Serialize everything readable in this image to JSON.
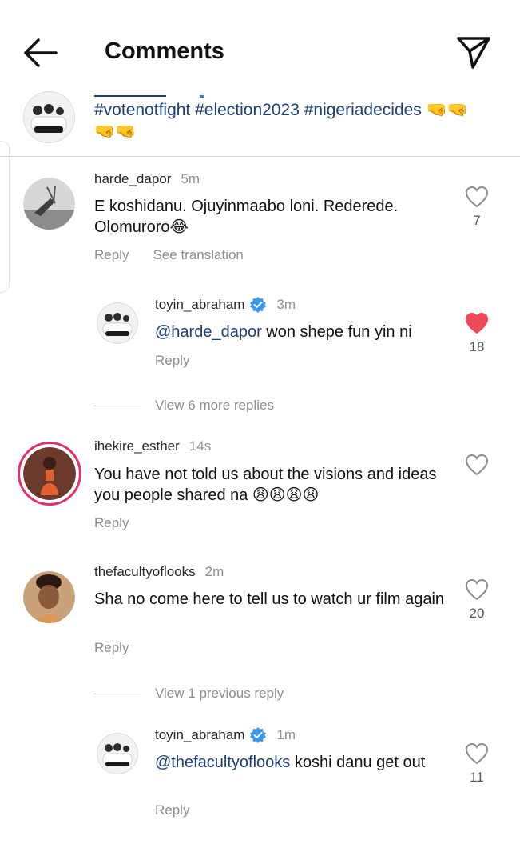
{
  "header": {
    "title": "Comments",
    "back_icon": "arrow-left-icon",
    "send_icon": "paper-plane-icon"
  },
  "caption": {
    "text": "#votenotfight #election2023 #nigeriadecides 🤜🤜🤜🤜"
  },
  "comments": [
    {
      "username": "harde_dapor",
      "time": "5m",
      "text": "E koshidanu. Ojuyinmaabo loni. Rederede. Olomuroro😂",
      "reply": "Reply",
      "translate": "See translation",
      "likes": "7",
      "liked": false
    },
    {
      "username": "toyin_abraham",
      "time": "3m",
      "mention": "@harde_dapor",
      "text": " won shepe fun yin ni",
      "reply": "Reply",
      "likes": "18",
      "liked": true
    },
    {
      "username": "ihekire_esther",
      "time": "14s",
      "text": "You have not told us about the visions and ideas you people shared na 😩😩😩😩",
      "reply": "Reply",
      "likes": "",
      "liked": false
    },
    {
      "username": "thefacultyoflooks",
      "time": "2m",
      "text": "Sha no come here to tell us to watch ur film again",
      "reply": "Reply",
      "likes": "20",
      "liked": false
    },
    {
      "username": "toyin_abraham",
      "time": "1m",
      "mention": "@thefacultyoflooks",
      "text": " koshi danu get out",
      "reply": "Reply",
      "likes": "11",
      "liked": false
    }
  ],
  "view_more_replies": "View 6 more replies",
  "view_previous_reply": "View 1 previous reply",
  "colors": {
    "mention": "#1c3f7a",
    "liked_heart": "#ed4956",
    "muted": "#8e8e8e",
    "story_ring": "#e1306c"
  }
}
